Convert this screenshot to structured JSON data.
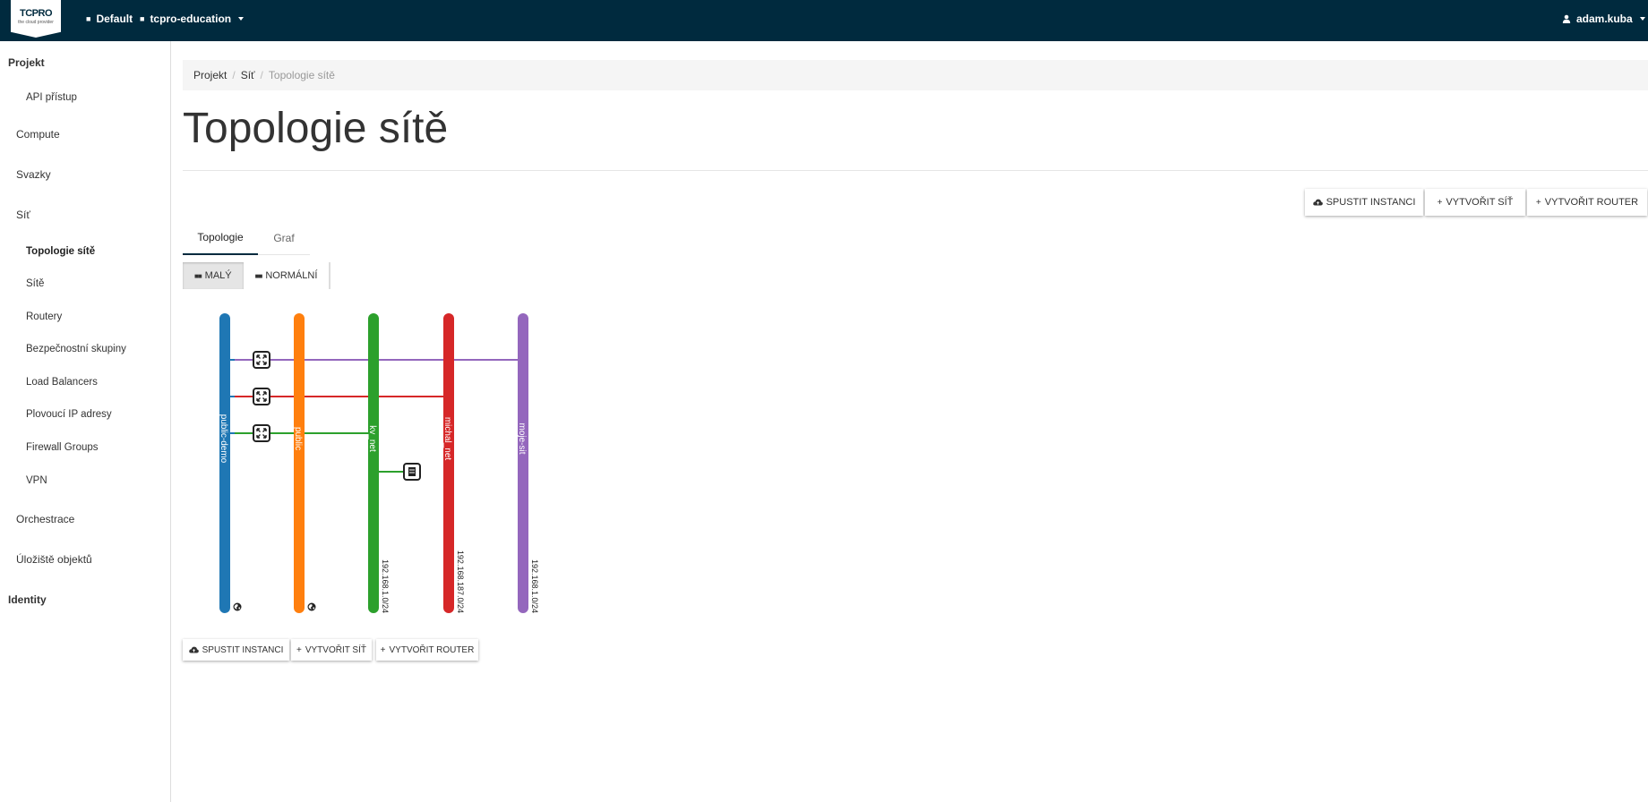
{
  "header": {
    "logo_text": "TCPRO",
    "logo_sub": "the cloud provider",
    "domain": "Default",
    "project": "tcpro-education",
    "user": "adam.kuba"
  },
  "sidebar": {
    "sections": [
      "Projekt",
      "Identity"
    ],
    "items": {
      "api": "API přístup",
      "compute": "Compute",
      "volumes": "Svazky",
      "network": "Síť",
      "topology": "Topologie sítě",
      "networks": "Sítě",
      "routers": "Routery",
      "security_groups": "Bezpečnostní skupiny",
      "load_balancers": "Load Balancers",
      "floating_ips": "Plovoucí IP adresy",
      "firewall_groups": "Firewall Groups",
      "vpn": "VPN",
      "orchestration": "Orchestrace",
      "object_store": "Úložiště objektů"
    }
  },
  "breadcrumb": [
    "Projekt",
    "Síť",
    "Topologie sítě"
  ],
  "page_title": "Topologie sítě",
  "actions": {
    "launch_instance": "SPUSTIT INSTANCI",
    "create_network": "VYTVOŘIT SÍŤ",
    "create_router": "VYTVOŘIT ROUTER"
  },
  "tabs": [
    "Topologie",
    "Graf"
  ],
  "size_toggle": {
    "small": "MALÝ",
    "normal": "NORMÁLNÍ"
  },
  "topology": {
    "networks": [
      {
        "name": "public-demo",
        "color": "#1f77b4",
        "cidr": "",
        "external": true
      },
      {
        "name": "public",
        "color": "#ff7f0e",
        "cidr": "",
        "external": true
      },
      {
        "name": "kv_net",
        "color": "#2ca02c",
        "cidr": "192.168.1.0/24",
        "external": false
      },
      {
        "name": "michal_net",
        "color": "#d62728",
        "cidr": "192.168.187.0/24",
        "external": false
      },
      {
        "name": "moje-sit",
        "color": "#9467bd",
        "cidr": "192.168.1.0/24",
        "external": false
      }
    ],
    "routers": [
      {
        "from": 0,
        "to": 4
      },
      {
        "from": 0,
        "to": 3
      },
      {
        "from": 0,
        "to": 2
      }
    ],
    "instances": [
      {
        "network": 2
      }
    ],
    "colors": {
      "router_line_purple": "#9467bd",
      "router_line_red": "#d62728",
      "router_line_green": "#2ca02c"
    },
    "icons": [
      "router-icon",
      "instance-icon",
      "globe-icon"
    ]
  }
}
